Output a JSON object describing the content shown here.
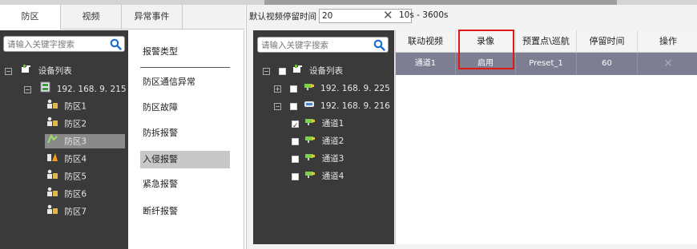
{
  "left_tabs": [
    "防区",
    "视频",
    "异常事件"
  ],
  "zone_tree": {
    "search_placeholder": "请输入关键字搜索",
    "root": "设备列表",
    "device": "192. 168. 9. 215",
    "zones": [
      "防区1",
      "防区2",
      "防区3",
      "防区4",
      "防区5",
      "防区6",
      "防区7"
    ],
    "selected_zone_index": 2
  },
  "alarm_types": {
    "heading": "报警类型",
    "items": [
      "防区通信异常",
      "防区故障",
      "防拆报警",
      "入侵报警",
      "紧急报警",
      "断纤报警"
    ],
    "active_index": 3
  },
  "video_settings": {
    "stay_label": "默认视频停留时间",
    "stay_value": "20",
    "range_hint": "10s - 3600s"
  },
  "camera_tree": {
    "search_placeholder": "请输入关键字搜索",
    "root": "设备列表",
    "devices": [
      {
        "label": "192. 168. 9. 225",
        "expanded": false,
        "checked": false
      },
      {
        "label": "192. 168. 9. 216",
        "expanded": true,
        "checked": false
      }
    ],
    "channels": [
      {
        "label": "通道1",
        "checked": true
      },
      {
        "label": "通道2",
        "checked": false
      },
      {
        "label": "通道3",
        "checked": false
      },
      {
        "label": "通道4",
        "checked": false
      }
    ]
  },
  "link_table": {
    "columns": [
      "联动视频",
      "录像",
      "预置点\\巡航",
      "停留时间",
      "操作"
    ],
    "rows": [
      {
        "video": "通道1",
        "record": "启用",
        "preset": "Preset_1",
        "stay": "60",
        "action": "✕"
      }
    ]
  },
  "colors": {
    "tree_bg": "#3a3a3a",
    "row_bg": "#7e7e92",
    "highlight": "#e01818",
    "search_icon": "#1a6fd0"
  }
}
